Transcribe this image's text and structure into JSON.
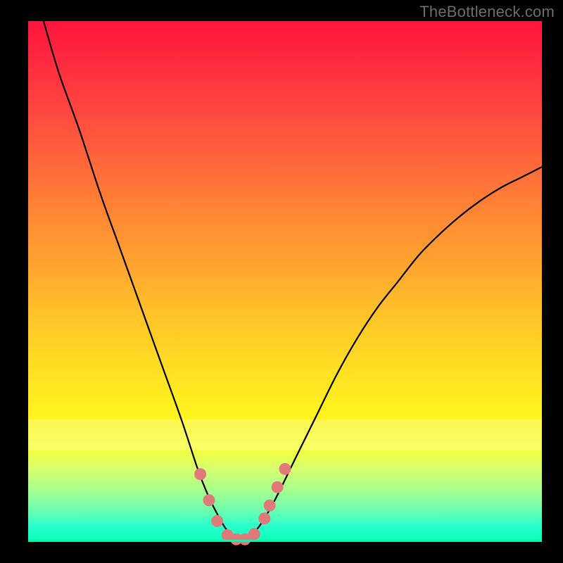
{
  "watermark": "TheBottleneck.com",
  "colors": {
    "curve": "#000000",
    "dots": "#e07a7a",
    "frame": "#000000"
  },
  "chart_data": {
    "type": "line",
    "title": "",
    "xlabel": "",
    "ylabel": "",
    "xlim": [
      0,
      100
    ],
    "ylim": [
      0,
      100
    ],
    "grid": false,
    "legend": false,
    "series": [
      {
        "name": "bottleneck-curve",
        "x": [
          3,
          6,
          10,
          14,
          18,
          22,
          26,
          30,
          33,
          35,
          37,
          38.5,
          40,
          41.5,
          43,
          45,
          48,
          52,
          56,
          60,
          64,
          68,
          72,
          76,
          80,
          84,
          88,
          92,
          96,
          100
        ],
        "y": [
          100,
          90,
          79,
          67,
          56,
          45,
          34,
          23,
          14,
          9,
          5,
          2.5,
          1,
          0.3,
          1,
          3,
          8,
          16,
          24,
          32,
          39,
          45,
          50,
          55,
          59,
          62.5,
          65.5,
          68,
          70,
          72
        ]
      }
    ],
    "markers": [
      {
        "x": 33.5,
        "y": 13
      },
      {
        "x": 35.2,
        "y": 8
      },
      {
        "x": 36.8,
        "y": 4
      },
      {
        "x": 38.8,
        "y": 1.3
      },
      {
        "x": 40.5,
        "y": 0.5
      },
      {
        "x": 42.2,
        "y": 0.5
      },
      {
        "x": 44.0,
        "y": 1.5
      },
      {
        "x": 46.0,
        "y": 4.5
      },
      {
        "x": 47.0,
        "y": 7
      },
      {
        "x": 48.5,
        "y": 10.5
      },
      {
        "x": 50.0,
        "y": 14
      }
    ],
    "gradient_meaning": "red (top) = high bottleneck, green (bottom) = low bottleneck"
  }
}
